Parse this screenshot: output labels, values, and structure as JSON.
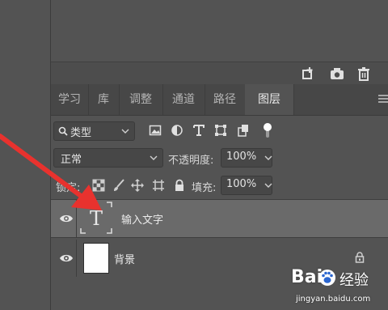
{
  "tabs": [
    {
      "label": "学习",
      "active": false
    },
    {
      "label": "库",
      "active": false
    },
    {
      "label": "调整",
      "active": false
    },
    {
      "label": "通道",
      "active": false
    },
    {
      "label": "路径",
      "active": false
    },
    {
      "label": "图层",
      "active": true
    }
  ],
  "filter": {
    "kind_label": "类型",
    "icons": [
      "image-filter-icon",
      "adjustment-filter-icon",
      "type-filter-icon",
      "shape-filter-icon",
      "smart-object-filter-icon",
      "toggle-filter-icon"
    ]
  },
  "blend": {
    "mode": "正常",
    "opacity_label": "不透明度:",
    "opacity": "100%"
  },
  "lock": {
    "label": "锁定:",
    "fill_label": "填充:",
    "fill": "100%"
  },
  "layers": [
    {
      "name": "输入文字",
      "type": "text",
      "selected": true,
      "visible": true,
      "locked": false
    },
    {
      "name": "背景",
      "type": "image",
      "selected": false,
      "visible": true,
      "locked": true
    }
  ],
  "text_thumb_glyph": "T",
  "watermark": {
    "logo": "Bai",
    "cn": "经验",
    "url": "jingyan.baidu.com"
  },
  "colors": {
    "panel": "#535353",
    "selected_layer": "#6a6a6a",
    "arrow": "#e8322e"
  }
}
